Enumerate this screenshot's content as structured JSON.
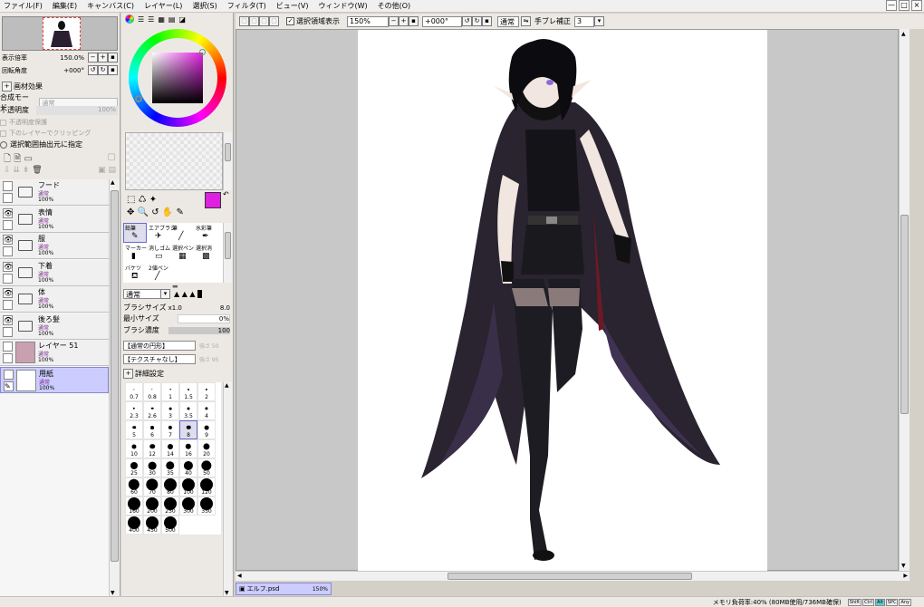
{
  "menu": [
    "ファイル(F)",
    "編集(E)",
    "キャンバス(C)",
    "レイヤー(L)",
    "選択(S)",
    "フィルタ(T)",
    "ビュー(V)",
    "ウィンドウ(W)",
    "その他(O)"
  ],
  "navigator": {
    "zoom_label": "表示倍率",
    "zoom_value": "150.0%",
    "rotate_label": "回転角度",
    "rotate_value": "+000°"
  },
  "layer_panel": {
    "effects_label": "画材効果",
    "blend_label": "合成モード",
    "blend_value": "通常",
    "opacity_label": "不透明度",
    "opacity_value": "100%",
    "protect_label": "不透明度保護",
    "clip_label": "下のレイヤーでクリッピング",
    "source_label": "選択範囲抽出元に指定",
    "layers": [
      {
        "name": "フード",
        "mode": "通常",
        "opacity": "100%",
        "visible": false,
        "type": "folder"
      },
      {
        "name": "表情",
        "mode": "通常",
        "opacity": "100%",
        "visible": true,
        "type": "folder"
      },
      {
        "name": "服",
        "mode": "通常",
        "opacity": "100%",
        "visible": true,
        "type": "folder"
      },
      {
        "name": "下着",
        "mode": "通常",
        "opacity": "100%",
        "visible": true,
        "type": "folder"
      },
      {
        "name": "体",
        "mode": "通常",
        "opacity": "100%",
        "visible": true,
        "type": "folder"
      },
      {
        "name": "後ろ髪",
        "mode": "通常",
        "opacity": "100%",
        "visible": true,
        "type": "folder"
      },
      {
        "name": "レイヤー 51",
        "mode": "通常",
        "opacity": "100%",
        "visible": false,
        "type": "layer"
      },
      {
        "name": "用紙",
        "mode": "通常",
        "opacity": "100%",
        "visible": false,
        "type": "paper"
      }
    ]
  },
  "tools": [
    {
      "label": "鉛筆",
      "icon": "✎"
    },
    {
      "label": "エアブラシ",
      "icon": "✈"
    },
    {
      "label": "筆",
      "icon": "╱"
    },
    {
      "label": "水彩筆",
      "icon": "✒"
    },
    {
      "label": "マーカー",
      "icon": "▮"
    },
    {
      "label": "消しゴム",
      "icon": "▭"
    },
    {
      "label": "選択ペン",
      "icon": "▦"
    },
    {
      "label": "選択消",
      "icon": "▩"
    },
    {
      "label": "バケツ",
      "icon": "⛾"
    },
    {
      "label": "2値ペン",
      "icon": "╱"
    }
  ],
  "brush": {
    "mode": "通常",
    "size_label": "ブラシサイズ",
    "size_mult": "x1.0",
    "size_value": "8.0",
    "min_label": "最小サイズ",
    "min_value": "0%",
    "density_label": "ブラシ濃度",
    "density_value": "100",
    "shape": "【通常の円形】",
    "texture": "【テクスチャなし】",
    "strength1": "強さ 50",
    "strength2": "強さ 95",
    "detail_label": "詳細設定"
  },
  "brush_sizes": [
    "0.7",
    "0.8",
    "1",
    "1.5",
    "2",
    "2.3",
    "2.6",
    "3",
    "3.5",
    "4",
    "5",
    "6",
    "7",
    "8",
    "9",
    "10",
    "12",
    "14",
    "16",
    "20",
    "25",
    "30",
    "35",
    "40",
    "50",
    "60",
    "70",
    "80",
    "100",
    "120",
    "160",
    "200",
    "250",
    "300",
    "350",
    "400",
    "450",
    "500"
  ],
  "toolbar": {
    "selection_show": "選択領域表示",
    "zoom": "150%",
    "angle": "+000°",
    "blend": "通常",
    "stabilizer_label": "手ブレ補正",
    "stabilizer_value": "3"
  },
  "tab": {
    "name": "エルフ.psd",
    "zoom": "150%"
  },
  "status": {
    "memory": "メモリ負荷率:40% (80MB使用/736MB確保)",
    "keys": [
      "Shift",
      "Ctrl",
      "Alt",
      "SPC",
      "Any"
    ]
  },
  "colors": {
    "primary": "#e020e0",
    "secondary": "#ffffff",
    "panel": "#ece9e4",
    "canvas_bg": "#c8c8c8"
  }
}
